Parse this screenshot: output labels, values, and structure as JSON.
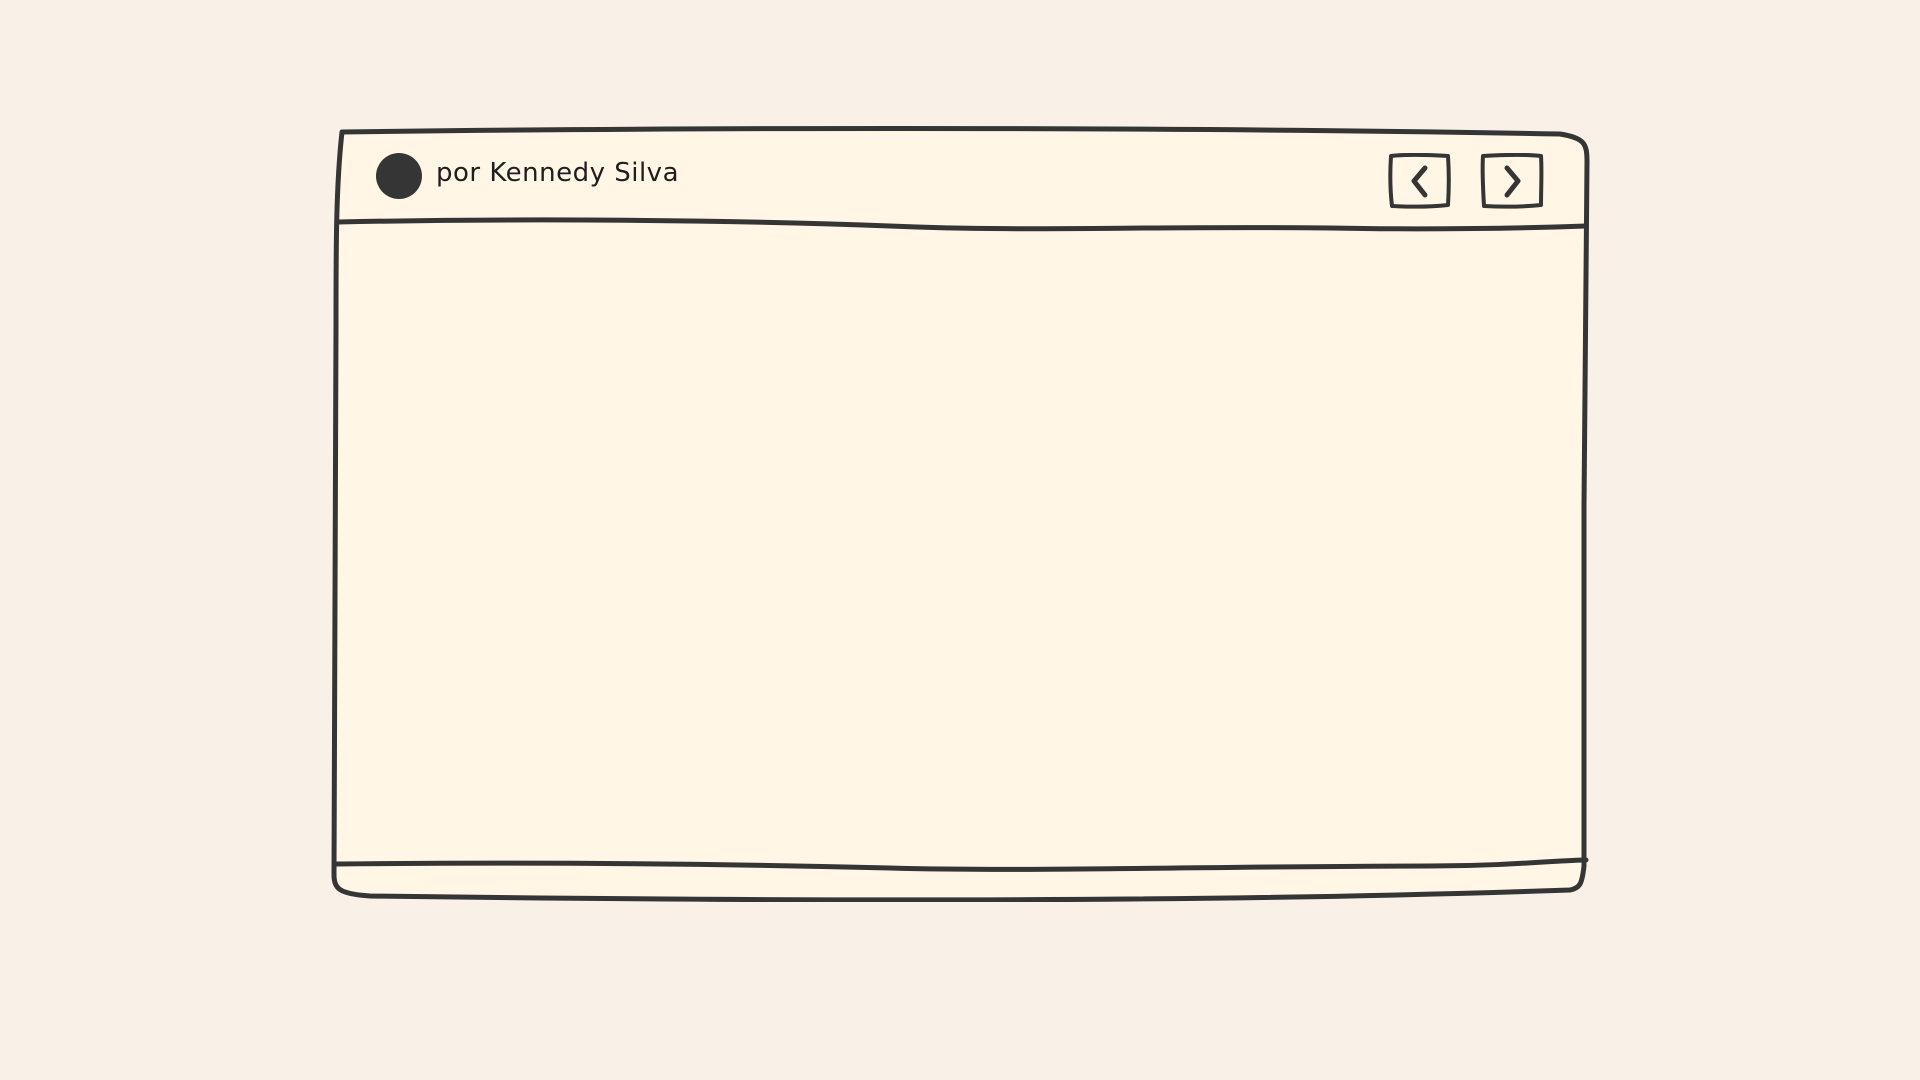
{
  "titlebar": {
    "author_label": "por Kennedy Silva"
  },
  "icons": {
    "prev": "chevron-left-icon",
    "next": "chevron-right-icon",
    "avatar": "avatar-dot"
  },
  "colors": {
    "page_background": "#f9f1e7",
    "window_fill": "#fff6e6",
    "stroke": "#363535"
  }
}
